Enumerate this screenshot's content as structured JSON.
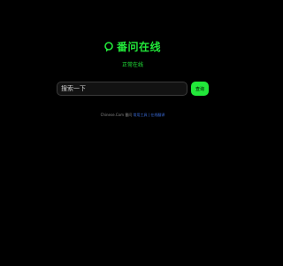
{
  "brand": {
    "icon": "chat-bubble-icon",
    "title": "番问在线",
    "accent_color": "#22e83a"
  },
  "status": {
    "text": "正常在线"
  },
  "search": {
    "placeholder": "搜索一下",
    "value": "",
    "button_label": "查询"
  },
  "footer": {
    "copyright": "Chinese.Com 番问",
    "links": "常用工具 | 在线翻译"
  }
}
